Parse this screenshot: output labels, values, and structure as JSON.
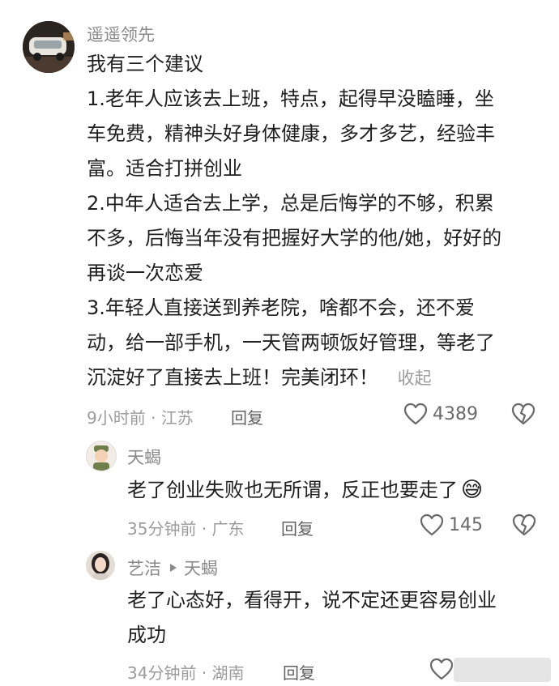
{
  "comments": [
    {
      "user": "遥遥领先",
      "lines": [
        "我有三个建议",
        "1.老年人应该去上班，特点，起得早没瞌睡，坐",
        "车免费，精神头好身体健康，多才多艺，经验丰",
        "富。适合打拼创业",
        "2.中年人适合去上学，总是后悔学的不够，积累",
        "不多，后悔当年没有把握好大学的他/她，好好的",
        "再谈一次恋爱",
        "3.年轻人直接送到养老院，啥都不会，还不爱",
        "动，给一部手机，一天管两顿饭好管理，等老了",
        "沉淀好了直接去上班！完美闭环！"
      ],
      "collapse_label": "收起",
      "time_location": "9小时前 · 江苏",
      "reply_label": "回复",
      "likes": "4389",
      "like_icon": "heart-outline-icon",
      "dislike_icon": "broken-heart-icon"
    }
  ],
  "replies": [
    {
      "user": "天蝎",
      "text": "老了创业失败也无所谓，反正也要走了",
      "emoji": "😅",
      "time_location": "35分钟前 · 广东",
      "reply_label": "回复",
      "likes": "145"
    },
    {
      "user": "艺洁",
      "reply_to": "天蝎",
      "lines": [
        "老了心态好，看得开，说不定还更容易创业",
        "成功"
      ],
      "time_location": "34分钟前 · 湖南",
      "reply_label": "回复"
    }
  ],
  "colors": {
    "name": "#8a8a8a",
    "text": "#1f1f1f",
    "meta": "#9c9c9c"
  }
}
